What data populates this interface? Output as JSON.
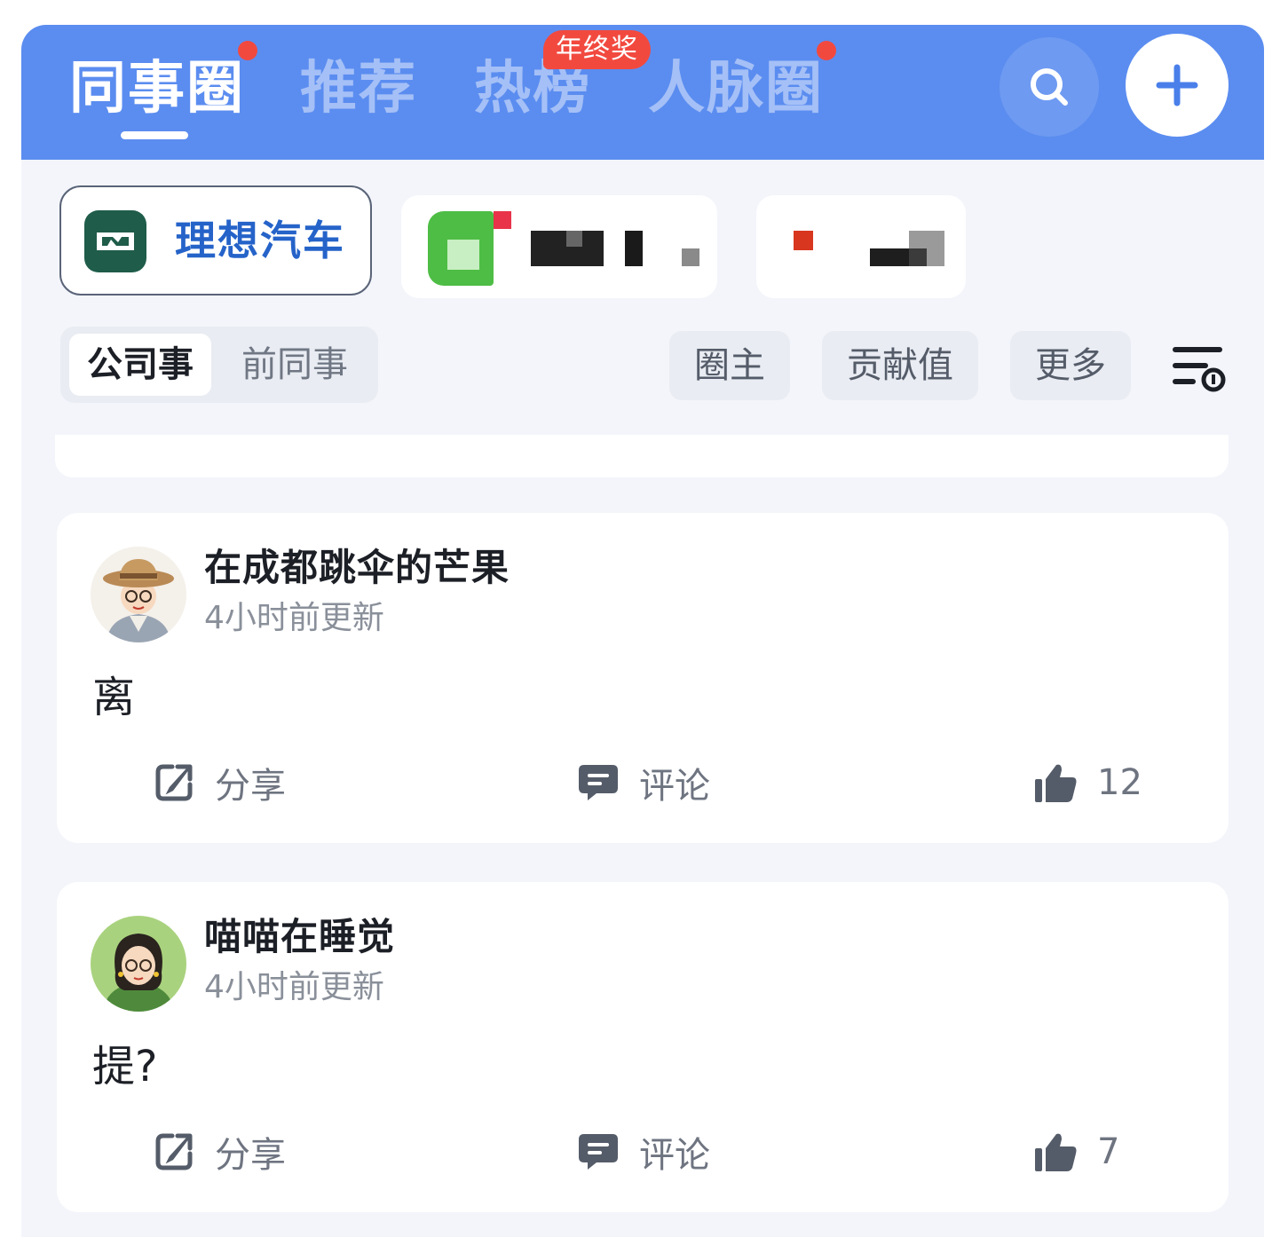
{
  "header": {
    "tabs": [
      {
        "label": "同事圈",
        "active": true
      },
      {
        "label": "推荐",
        "active": false
      },
      {
        "label": "热榜",
        "active": false
      },
      {
        "label": "人脉圈",
        "active": false
      }
    ],
    "badge": "年终奖",
    "accent_color": "#5b8df0",
    "dot_color": "#f2493f",
    "search_icon": "search-icon",
    "add_icon": "plus-icon"
  },
  "companies": {
    "selected": {
      "name": "理想汽车",
      "logo_icon": "li-auto-logo"
    }
  },
  "filters": {
    "segments": [
      "公司事",
      "前同事"
    ],
    "pills": [
      "圈主",
      "贡献值",
      "更多"
    ],
    "sort_icon": "filter-sort-icon"
  },
  "posts": [
    {
      "author": "在成都跳伞的芒果",
      "time": "4小时前更新",
      "content": "离",
      "share_label": "分享",
      "comment_label": "评论",
      "likes": "12"
    },
    {
      "author": "喵喵在睡觉",
      "time": "4小时前更新",
      "content": "提?",
      "share_label": "分享",
      "comment_label": "评论",
      "likes": "7"
    }
  ]
}
